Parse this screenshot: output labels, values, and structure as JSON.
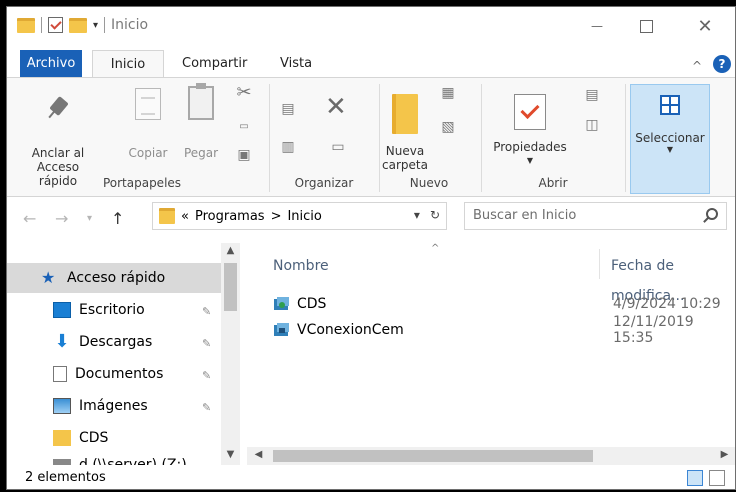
{
  "titlebar": {
    "title": "Inicio",
    "controls": {
      "minimize": "—",
      "close": "✕"
    }
  },
  "ribbon_tabs": {
    "file": "Archivo",
    "home": "Inicio",
    "share": "Compartir",
    "view": "Vista"
  },
  "ribbon": {
    "portapapeles": {
      "label": "Portapapeles",
      "pin_line1": "Anclar al",
      "pin_line2": "Acceso rápido",
      "copy": "Copiar",
      "paste": "Pegar"
    },
    "organizar": {
      "label": "Organizar"
    },
    "nuevo": {
      "label": "Nuevo",
      "new_folder_line1": "Nueva",
      "new_folder_line2": "carpeta"
    },
    "abrir": {
      "label": "Abrir",
      "properties": "Propiedades"
    },
    "seleccionar": {
      "label": "Seleccionar"
    }
  },
  "address": {
    "prefix": "«",
    "path": [
      "Programas",
      "Inicio"
    ],
    "separator": ">",
    "search_placeholder": "Buscar en Inicio"
  },
  "navpane": {
    "items": [
      {
        "label": "Acceso rápido",
        "icon": "star-icon",
        "color": "#1a61b7",
        "pinned": false,
        "selected": true
      },
      {
        "label": "Escritorio",
        "icon": "desktop-icon",
        "color": "#1a7fd4",
        "pinned": true,
        "selected": false
      },
      {
        "label": "Descargas",
        "icon": "download-icon",
        "color": "#1a7fd4",
        "pinned": true,
        "selected": false
      },
      {
        "label": "Documentos",
        "icon": "document-icon",
        "color": "#777777",
        "pinned": true,
        "selected": false
      },
      {
        "label": "Imágenes",
        "icon": "image-icon",
        "color": "#3a8fd4",
        "pinned": true,
        "selected": false
      },
      {
        "label": "CDS",
        "icon": "folder-icon",
        "color": "#f4c54a",
        "pinned": false,
        "selected": false
      },
      {
        "label": "d (\\\\server) (Z:)",
        "icon": "network-drive-icon",
        "color": "#777777",
        "pinned": false,
        "selected": false
      }
    ]
  },
  "filelist": {
    "columns": {
      "name": "Nombre",
      "date": "Fecha de modifica..."
    },
    "rows": [
      {
        "name": "CDS",
        "date": "4/9/2024 10:29",
        "icon": "app-shortcut-icon"
      },
      {
        "name": "VConexionCem",
        "date": "12/11/2019 15:35",
        "icon": "app-shortcut-icon"
      }
    ]
  },
  "statusbar": {
    "count": "2 elementos"
  }
}
